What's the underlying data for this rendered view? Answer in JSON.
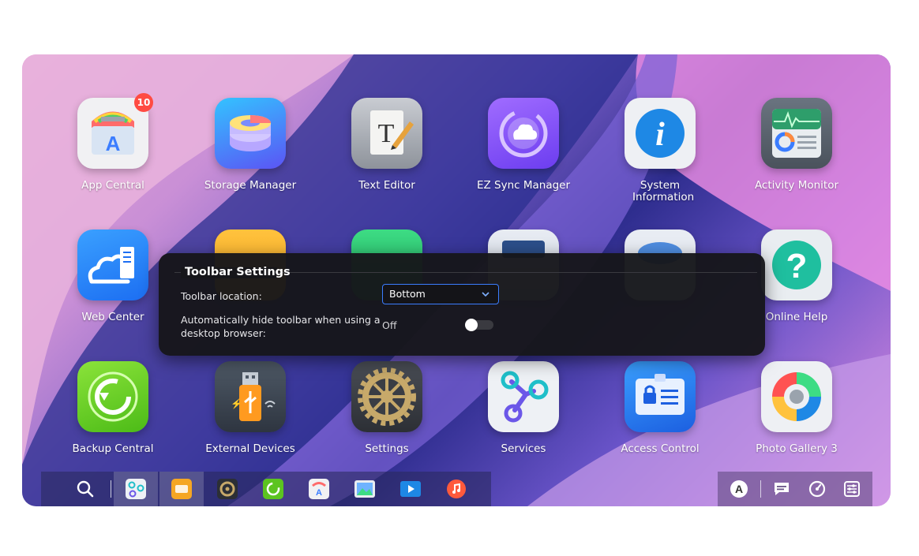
{
  "apps": [
    {
      "id": "app-central",
      "label": "App Central",
      "badge": "10",
      "icon": "app-central-icon"
    },
    {
      "id": "storage-manager",
      "label": "Storage Manager",
      "icon": "storage-manager-icon"
    },
    {
      "id": "text-editor",
      "label": "Text Editor",
      "icon": "text-editor-icon"
    },
    {
      "id": "ez-sync-manager",
      "label": "EZ Sync Manager",
      "icon": "ez-sync-icon"
    },
    {
      "id": "system-information",
      "label": "System Information",
      "icon": "info-icon"
    },
    {
      "id": "activity-monitor",
      "label": "Activity Monitor",
      "icon": "activity-monitor-icon"
    },
    {
      "id": "web-center",
      "label": "Web Center",
      "icon": "web-center-icon"
    },
    {
      "id": "online-help",
      "label": "Online Help",
      "icon": "help-icon"
    },
    {
      "id": "backup-central",
      "label": "Backup Central",
      "icon": "backup-icon"
    },
    {
      "id": "external-devices",
      "label": "External Devices",
      "icon": "usb-icon"
    },
    {
      "id": "settings",
      "label": "Settings",
      "icon": "gear-icon"
    },
    {
      "id": "services",
      "label": "Services",
      "icon": "services-icon"
    },
    {
      "id": "access-control",
      "label": "Access Control",
      "icon": "access-control-icon"
    },
    {
      "id": "photo-gallery-3",
      "label": "Photo Gallery 3",
      "icon": "photo-gallery-icon"
    }
  ],
  "dialog": {
    "title": "Toolbar Settings",
    "location_label": "Toolbar location:",
    "location_value": "Bottom",
    "autohide_label_1": "Automatically hide toolbar when using a",
    "autohide_label_2": "desktop browser:",
    "autohide_value": "Off",
    "autohide_on": false
  },
  "taskbar": [
    "search-icon",
    "services-icon",
    "storage-icon",
    "settings-icon",
    "backup-icon",
    "app-central-icon",
    "photo-icon",
    "video-icon",
    "music-icon"
  ],
  "tray": [
    "user-avatar-icon",
    "chat-icon",
    "dashboard-icon",
    "settings-sliders-icon"
  ],
  "tray_avatar_letter": "A",
  "colors": {
    "accent": "#3b7dff",
    "badge": "#ff4b42"
  }
}
